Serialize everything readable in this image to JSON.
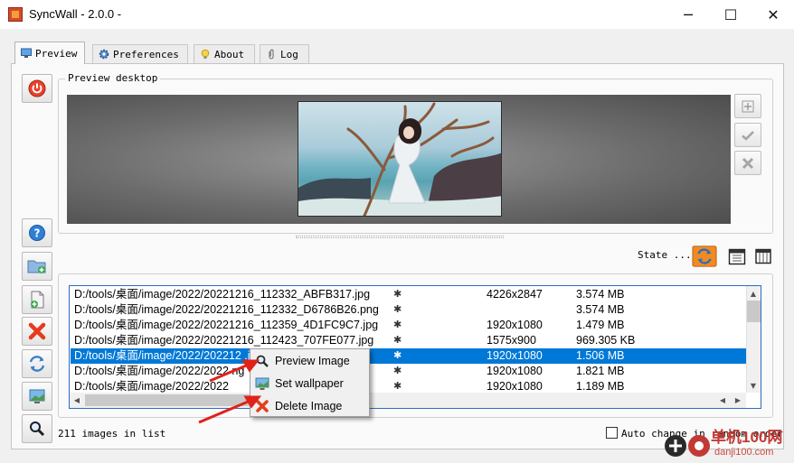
{
  "window": {
    "title": "SyncWall - 2.0.0 -",
    "minimize_glyph": "─",
    "maximize_glyph": "☐",
    "close_glyph": "✕"
  },
  "tabs": [
    {
      "label": "Preview",
      "icon": "monitor-icon",
      "active": true
    },
    {
      "label": "Preferences",
      "icon": "gear-icon",
      "active": false
    },
    {
      "label": "About",
      "icon": "lightbulb-icon",
      "active": false
    },
    {
      "label": "Log",
      "icon": "paperclip-icon",
      "active": false
    }
  ],
  "preview": {
    "group_label": "Preview desktop"
  },
  "state": {
    "label": "State ..."
  },
  "file_list": {
    "rows": [
      {
        "path": "D:/tools/桌面/image/2022/20221216_112332_ABFB317.jpg",
        "flag": "✱",
        "resolution": "4226x2847",
        "size": "3.574 MB",
        "selected": false
      },
      {
        "path": "D:/tools/桌面/image/2022/20221216_112332_D6786B26.png",
        "flag": "✱",
        "resolution": "",
        "size": "3.574 MB",
        "selected": false
      },
      {
        "path": "D:/tools/桌面/image/2022/20221216_112359_4D1FC9C7.jpg",
        "flag": "✱",
        "resolution": "1920x1080",
        "size": "1.479 MB",
        "selected": false
      },
      {
        "path": "D:/tools/桌面/image/2022/20221216_112423_707FE077.jpg",
        "flag": "✱",
        "resolution": "1575x900",
        "size": "969.305 KB",
        "selected": false
      },
      {
        "path": "D:/tools/桌面/image/2022/202212                    .jpg",
        "flag": "✱",
        "resolution": "1920x1080",
        "size": "1.506 MB",
        "selected": true
      },
      {
        "path": "D:/tools/桌面/image/2022/2022                       ng",
        "flag": "✱",
        "resolution": "1920x1080",
        "size": "1.821 MB",
        "selected": false
      },
      {
        "path": "D:/tools/桌面/image/2022/2022",
        "flag": "✱",
        "resolution": "1920x1080",
        "size": "1.189 MB",
        "selected": false
      }
    ]
  },
  "context_menu": {
    "items": [
      {
        "label": "Preview Image",
        "icon": "magnifier-icon"
      },
      {
        "label": "Set wallpaper",
        "icon": "wallpaper-icon"
      },
      {
        "label": "Delete Image",
        "icon": "delete-x-icon"
      }
    ]
  },
  "footer": {
    "count_text": "211 images in list",
    "auto_change_label": "Auto change in random order",
    "auto_change_checked": false
  },
  "watermark": {
    "text": "单机100网",
    "subtext": "danji100.com"
  },
  "colors": {
    "selection": "#0078d7",
    "power_button": "#e8412c",
    "delete_red": "#e53b1d",
    "state_orange": "#f08a24",
    "help_blue": "#2e7fd6",
    "arrow_red": "#e0221b"
  }
}
